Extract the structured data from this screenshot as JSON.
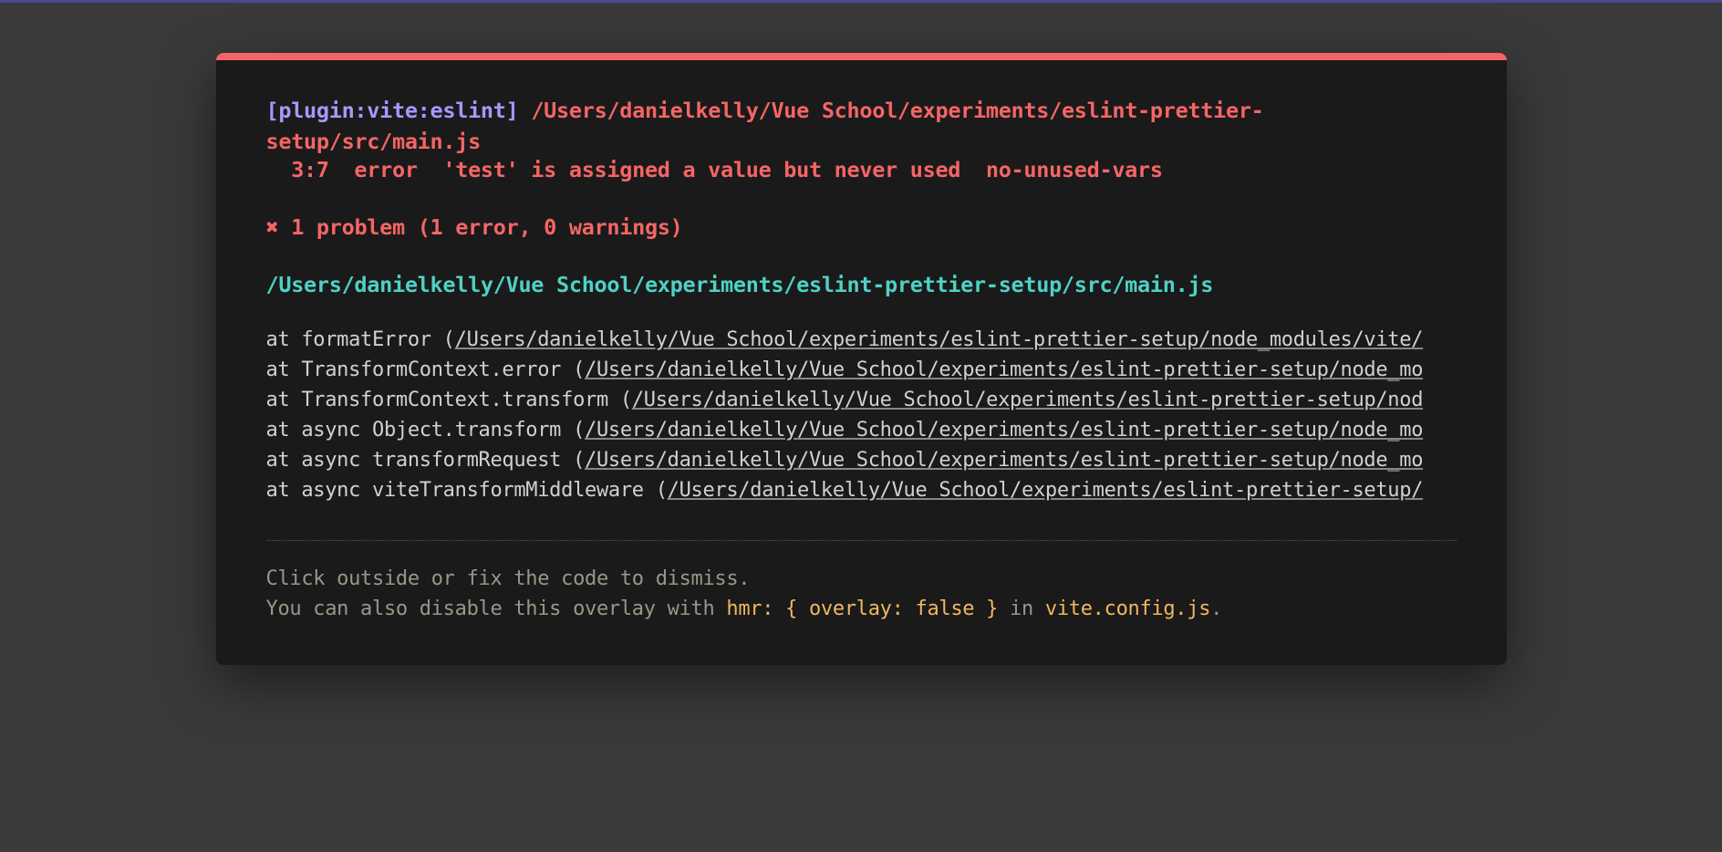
{
  "error": {
    "pluginTag": "[plugin:vite:eslint]",
    "filePath": "/Users/danielkelly/Vue School/experiments/eslint-prettier-setup/src/main.js",
    "detailLine": "  3:7  error  'test' is assigned a value but never used  no-unused-vars",
    "summaryIcon": "✖",
    "summaryText": "1 problem (1 error, 0 warnings)",
    "sourceFile": "/Users/danielkelly/Vue School/experiments/eslint-prettier-setup/src/main.js"
  },
  "stack": [
    {
      "prefix": "    at formatError (",
      "path": "/Users/danielkelly/Vue School/experiments/eslint-prettier-setup/node_modules/vite/"
    },
    {
      "prefix": "    at TransformContext.error (",
      "path": "/Users/danielkelly/Vue School/experiments/eslint-prettier-setup/node_mo"
    },
    {
      "prefix": "    at TransformContext.transform (",
      "path": "/Users/danielkelly/Vue School/experiments/eslint-prettier-setup/nod"
    },
    {
      "prefix": "    at async Object.transform (",
      "path": "/Users/danielkelly/Vue School/experiments/eslint-prettier-setup/node_mo"
    },
    {
      "prefix": "    at async transformRequest (",
      "path": "/Users/danielkelly/Vue School/experiments/eslint-prettier-setup/node_mo"
    },
    {
      "prefix": "    at async viteTransformMiddleware (",
      "path": "/Users/danielkelly/Vue School/experiments/eslint-prettier-setup/"
    }
  ],
  "tip": {
    "line1": "Click outside or fix the code to dismiss.",
    "line2a": "You can also disable this overlay with ",
    "hmrCode": "hmr: { overlay: false }",
    "line2b": " in ",
    "configFile": "vite.config.js",
    "line2c": "."
  }
}
